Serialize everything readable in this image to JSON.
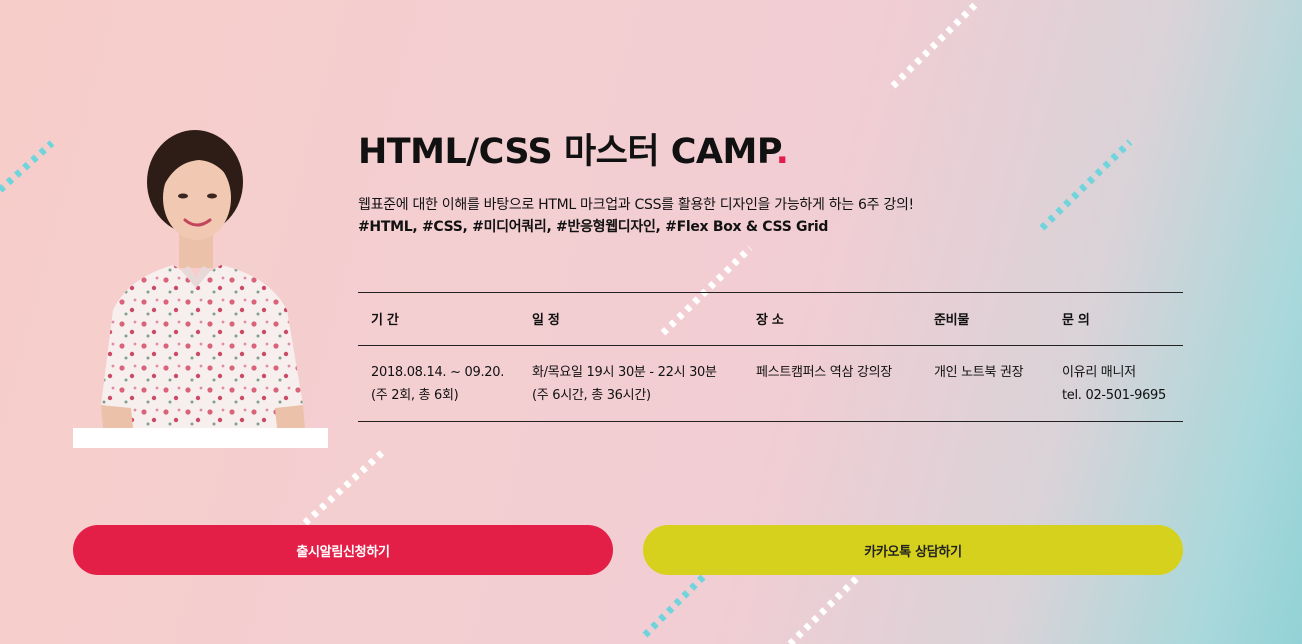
{
  "course": {
    "title": "HTML/CSS 마스터 CAMP",
    "title_dot": ".",
    "description": "웹표준에 대한 이해를 바탕으로 HTML 마크업과 CSS를 활용한 디자인을 가능하게 하는 6주 강의!",
    "tags": "#HTML, #CSS, #미디어쿼리, #반응형웹디자인, #Flex Box & CSS Grid"
  },
  "info_table": {
    "headers": [
      "기 간",
      "일 정",
      "장 소",
      "준비물",
      "문 의"
    ],
    "period": [
      "2018.08.14. ~ 09.20.",
      "(주 2회, 총 6회)"
    ],
    "schedule": [
      "화/목요일 19시 30분 - 22시 30분",
      "(주 6시간, 총 36시간)"
    ],
    "place": [
      "페스트캠퍼스 역삼 강의장"
    ],
    "supplies": [
      "개인 노트북 권장"
    ],
    "contact": [
      "이유리 매니저",
      "tel. 02-501-9695"
    ]
  },
  "buttons": {
    "notify": "출시알림신청하기",
    "kakao": "카카오톡 상담하기"
  },
  "colors": {
    "accent_red": "#e31f47",
    "accent_yellow": "#d6d11d",
    "deco_white": "#ffffff",
    "deco_teal": "#6fd4dc"
  },
  "icons": {
    "instructor": "instructor-portrait"
  }
}
